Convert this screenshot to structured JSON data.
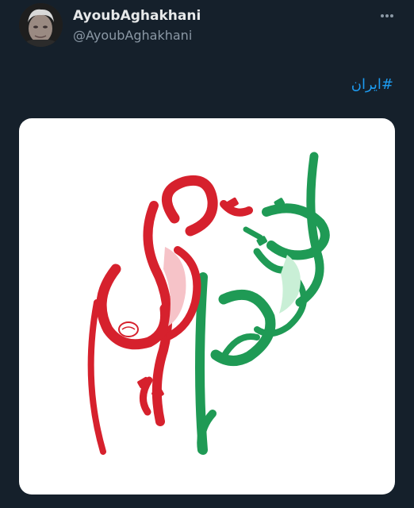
{
  "tweet": {
    "author": {
      "display_name": "AyoubAghakhani",
      "handle": "@AyoubAghakhani"
    },
    "text": "#ایران",
    "media": {
      "image_text": "اقتدار ملی ایرانی",
      "colors": {
        "green": "#1f9a55",
        "red": "#d6212d",
        "white": "#ffffff"
      }
    },
    "more_icon": "more-horizontal-icon"
  },
  "theme": {
    "background": "#15202b",
    "text_primary": "#e7e9ea",
    "text_secondary": "#8b98a5",
    "link": "#1d9bf0"
  }
}
